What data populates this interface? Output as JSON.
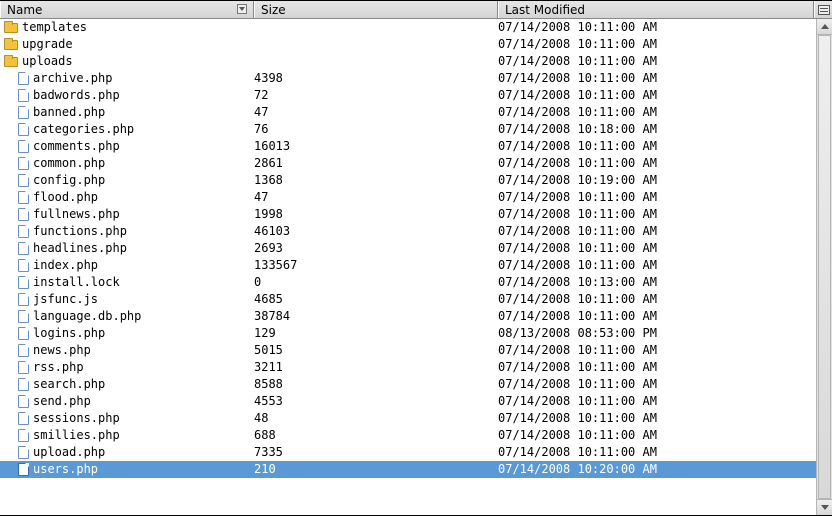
{
  "columns": {
    "name": "Name",
    "size": "Size",
    "modified": "Last Modified"
  },
  "rows": [
    {
      "type": "folder",
      "indent": 0,
      "name": "templates",
      "size": "",
      "mod": "07/14/2008 10:11:00 AM",
      "selected": false
    },
    {
      "type": "folder",
      "indent": 0,
      "name": "upgrade",
      "size": "",
      "mod": "07/14/2008 10:11:00 AM",
      "selected": false
    },
    {
      "type": "folder",
      "indent": 0,
      "name": "uploads",
      "size": "",
      "mod": "07/14/2008 10:11:00 AM",
      "selected": false
    },
    {
      "type": "file",
      "indent": 1,
      "name": "archive.php",
      "size": "4398",
      "mod": "07/14/2008 10:11:00 AM",
      "selected": false
    },
    {
      "type": "file",
      "indent": 1,
      "name": "badwords.php",
      "size": "72",
      "mod": "07/14/2008 10:11:00 AM",
      "selected": false
    },
    {
      "type": "file",
      "indent": 1,
      "name": "banned.php",
      "size": "47",
      "mod": "07/14/2008 10:11:00 AM",
      "selected": false
    },
    {
      "type": "file",
      "indent": 1,
      "name": "categories.php",
      "size": "76",
      "mod": "07/14/2008 10:18:00 AM",
      "selected": false
    },
    {
      "type": "file",
      "indent": 1,
      "name": "comments.php",
      "size": "16013",
      "mod": "07/14/2008 10:11:00 AM",
      "selected": false
    },
    {
      "type": "file",
      "indent": 1,
      "name": "common.php",
      "size": "2861",
      "mod": "07/14/2008 10:11:00 AM",
      "selected": false
    },
    {
      "type": "file",
      "indent": 1,
      "name": "config.php",
      "size": "1368",
      "mod": "07/14/2008 10:19:00 AM",
      "selected": false
    },
    {
      "type": "file",
      "indent": 1,
      "name": "flood.php",
      "size": "47",
      "mod": "07/14/2008 10:11:00 AM",
      "selected": false
    },
    {
      "type": "file",
      "indent": 1,
      "name": "fullnews.php",
      "size": "1998",
      "mod": "07/14/2008 10:11:00 AM",
      "selected": false
    },
    {
      "type": "file",
      "indent": 1,
      "name": "functions.php",
      "size": "46103",
      "mod": "07/14/2008 10:11:00 AM",
      "selected": false
    },
    {
      "type": "file",
      "indent": 1,
      "name": "headlines.php",
      "size": "2693",
      "mod": "07/14/2008 10:11:00 AM",
      "selected": false
    },
    {
      "type": "file",
      "indent": 1,
      "name": "index.php",
      "size": "133567",
      "mod": "07/14/2008 10:11:00 AM",
      "selected": false
    },
    {
      "type": "file",
      "indent": 1,
      "name": "install.lock",
      "size": "0",
      "mod": "07/14/2008 10:13:00 AM",
      "selected": false
    },
    {
      "type": "file",
      "indent": 1,
      "name": "jsfunc.js",
      "size": "4685",
      "mod": "07/14/2008 10:11:00 AM",
      "selected": false
    },
    {
      "type": "file",
      "indent": 1,
      "name": "language.db.php",
      "size": "38784",
      "mod": "07/14/2008 10:11:00 AM",
      "selected": false
    },
    {
      "type": "file",
      "indent": 1,
      "name": "logins.php",
      "size": "129",
      "mod": "08/13/2008 08:53:00 PM",
      "selected": false
    },
    {
      "type": "file",
      "indent": 1,
      "name": "news.php",
      "size": "5015",
      "mod": "07/14/2008 10:11:00 AM",
      "selected": false
    },
    {
      "type": "file",
      "indent": 1,
      "name": "rss.php",
      "size": "3211",
      "mod": "07/14/2008 10:11:00 AM",
      "selected": false
    },
    {
      "type": "file",
      "indent": 1,
      "name": "search.php",
      "size": "8588",
      "mod": "07/14/2008 10:11:00 AM",
      "selected": false
    },
    {
      "type": "file",
      "indent": 1,
      "name": "send.php",
      "size": "4553",
      "mod": "07/14/2008 10:11:00 AM",
      "selected": false
    },
    {
      "type": "file",
      "indent": 1,
      "name": "sessions.php",
      "size": "48",
      "mod": "07/14/2008 10:11:00 AM",
      "selected": false
    },
    {
      "type": "file",
      "indent": 1,
      "name": "smillies.php",
      "size": "688",
      "mod": "07/14/2008 10:11:00 AM",
      "selected": false
    },
    {
      "type": "file",
      "indent": 1,
      "name": "upload.php",
      "size": "7335",
      "mod": "07/14/2008 10:11:00 AM",
      "selected": false
    },
    {
      "type": "file",
      "indent": 1,
      "name": "users.php",
      "size": "210",
      "mod": "07/14/2008 10:20:00 AM",
      "selected": true
    }
  ]
}
